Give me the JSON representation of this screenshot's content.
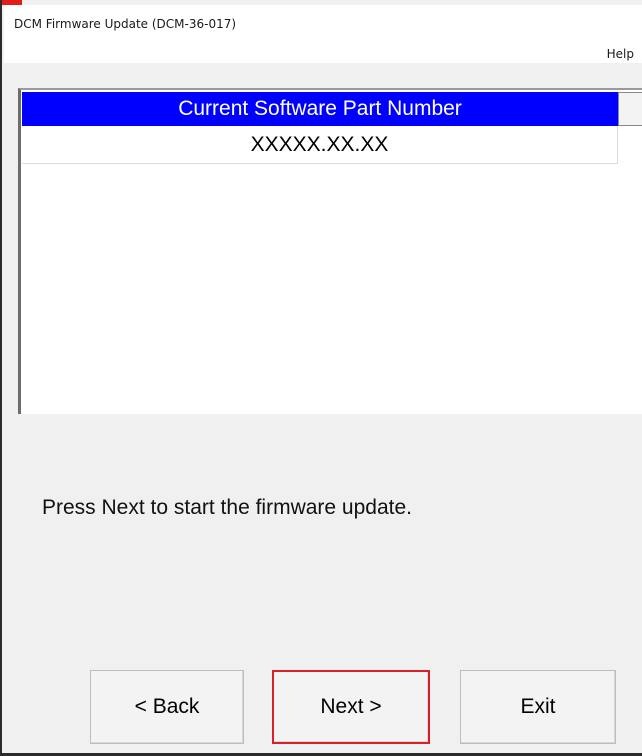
{
  "window": {
    "title": "DCM Firmware Update (DCM-36-017)"
  },
  "menu": {
    "help_label": "Help"
  },
  "list": {
    "header": "Current Software Part Number",
    "rows": [
      "XXXXX.XX.XX"
    ]
  },
  "instruction": "Press Next to start the firmware update.",
  "buttons": {
    "back_label": "< Back",
    "next_label": "Next >",
    "exit_label": "Exit"
  },
  "colors": {
    "header_bg": "#0000ff",
    "highlight_border": "#dc1f26"
  }
}
